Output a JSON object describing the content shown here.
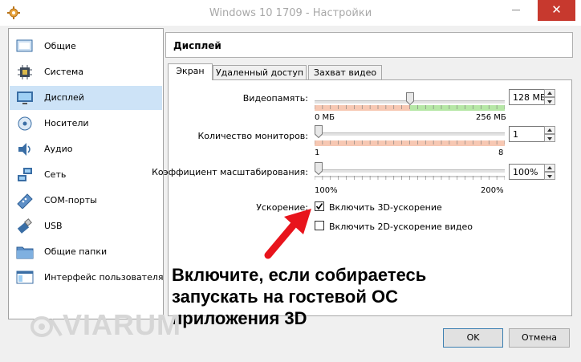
{
  "window": {
    "title": "Windows 10 1709 - Настройки",
    "close_glyph": "✕"
  },
  "sidebar": {
    "items": [
      {
        "label": "Общие",
        "icon": "general-icon"
      },
      {
        "label": "Система",
        "icon": "chip-icon"
      },
      {
        "label": "Дисплей",
        "icon": "monitor-icon",
        "selected": true
      },
      {
        "label": "Носители",
        "icon": "disk-icon"
      },
      {
        "label": "Аудио",
        "icon": "speaker-icon"
      },
      {
        "label": "Сеть",
        "icon": "network-icon"
      },
      {
        "label": "COM-порты",
        "icon": "serial-port-icon"
      },
      {
        "label": "USB",
        "icon": "usb-icon"
      },
      {
        "label": "Общие папки",
        "icon": "folder-icon"
      },
      {
        "label": "Интерфейс пользователя",
        "icon": "user-interface-icon"
      }
    ]
  },
  "section": {
    "title": "Дисплей"
  },
  "tabs": [
    {
      "label": "Экран",
      "active": true
    },
    {
      "label": "Удаленный доступ"
    },
    {
      "label": "Захват видео"
    }
  ],
  "screen": {
    "video_memory": {
      "label": "Видеопамять:",
      "value": "128 МБ",
      "min_label": "0 МБ",
      "max_label": "256 МБ",
      "fraction": 0.5
    },
    "monitors": {
      "label": "Количество мониторов:",
      "value": "1",
      "min_label": "1",
      "max_label": "8",
      "fraction": 0.0
    },
    "scale": {
      "label": "Коэффициент масштабирования:",
      "value": "100%",
      "min_label": "100%",
      "max_label": "200%",
      "fraction": 0.0
    },
    "acceleration": {
      "label": "Ускорение:",
      "enable_3d": {
        "label": "Включить 3D-ускорение",
        "checked": true
      },
      "enable_2d": {
        "label": "Включить 2D-ускорение видео",
        "checked": false
      }
    }
  },
  "annotation": {
    "lines": [
      "Включите, если собираетесь",
      "запускать на гостевой ОС",
      "приложения 3D"
    ]
  },
  "watermark": "VIARUM",
  "buttons": {
    "ok": "OK",
    "cancel": "Отмена"
  },
  "colors": {
    "selection": "#cde3f7",
    "warning_zone": "#f7c8b3",
    "ok_zone": "#b6e7a6",
    "close": "#c7392e",
    "arrow": "#e8141c"
  }
}
